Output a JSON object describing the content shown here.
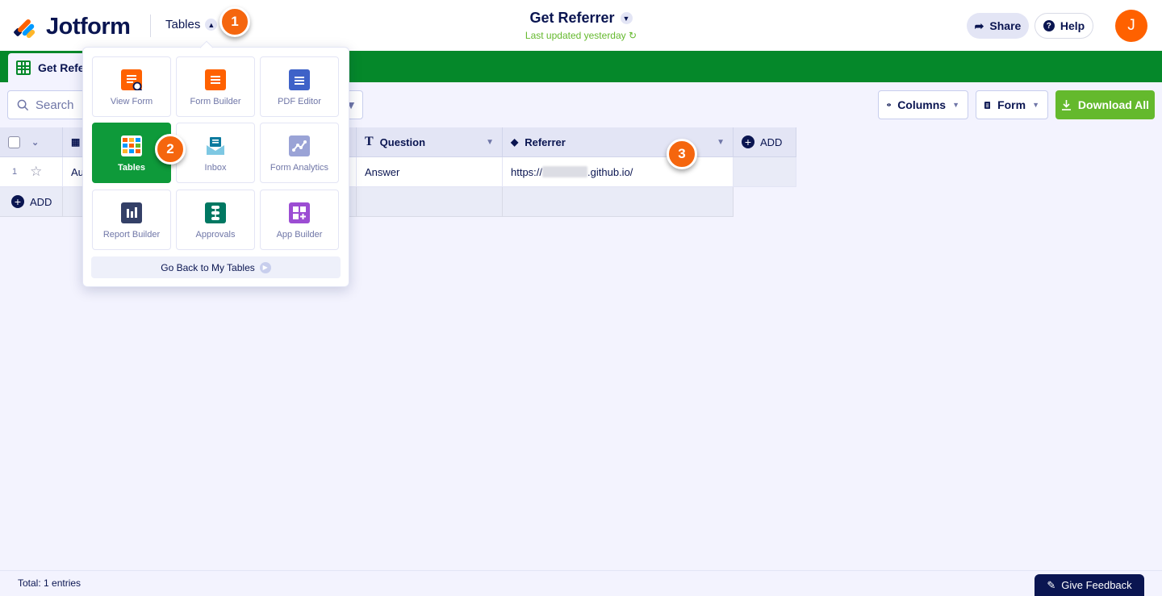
{
  "header": {
    "brand": "Jotform",
    "tables_menu_label": "Tables",
    "title": "Get Referrer",
    "last_updated": "Last updated yesterday",
    "share_label": "Share",
    "help_label": "Help",
    "avatar_initial": "J"
  },
  "tabs": [
    {
      "label": "Get Referrer"
    }
  ],
  "toolbar": {
    "search_placeholder": "Search",
    "columns_label": "Columns",
    "form_label": "Form",
    "download_label": "Download All"
  },
  "table": {
    "columns": [
      "Question",
      "Referrer"
    ],
    "add_column_label": "ADD",
    "rows": [
      {
        "index": "1",
        "date": "Au",
        "question": "Answer",
        "referrer_prefix": "https://",
        "referrer_suffix": ".github.io/"
      }
    ],
    "add_row_label": "ADD"
  },
  "popover": {
    "tiles": [
      {
        "label": "View Form"
      },
      {
        "label": "Form Builder"
      },
      {
        "label": "PDF Editor"
      },
      {
        "label": "Tables"
      },
      {
        "label": "Inbox"
      },
      {
        "label": "Form Analytics"
      },
      {
        "label": "Report Builder"
      },
      {
        "label": "Approvals"
      },
      {
        "label": "App Builder"
      }
    ],
    "go_back_label": "Go Back to My Tables"
  },
  "callouts": [
    "1",
    "2",
    "3"
  ],
  "footer": {
    "total": "Total: 1 entries",
    "feedback_label": "Give Feedback"
  },
  "colors": {
    "brand_navy": "#0a1551",
    "green_band": "#05882a",
    "download_green": "#64b92d",
    "accent_orange": "#ff6100",
    "callout_orange": "#f5660e"
  }
}
